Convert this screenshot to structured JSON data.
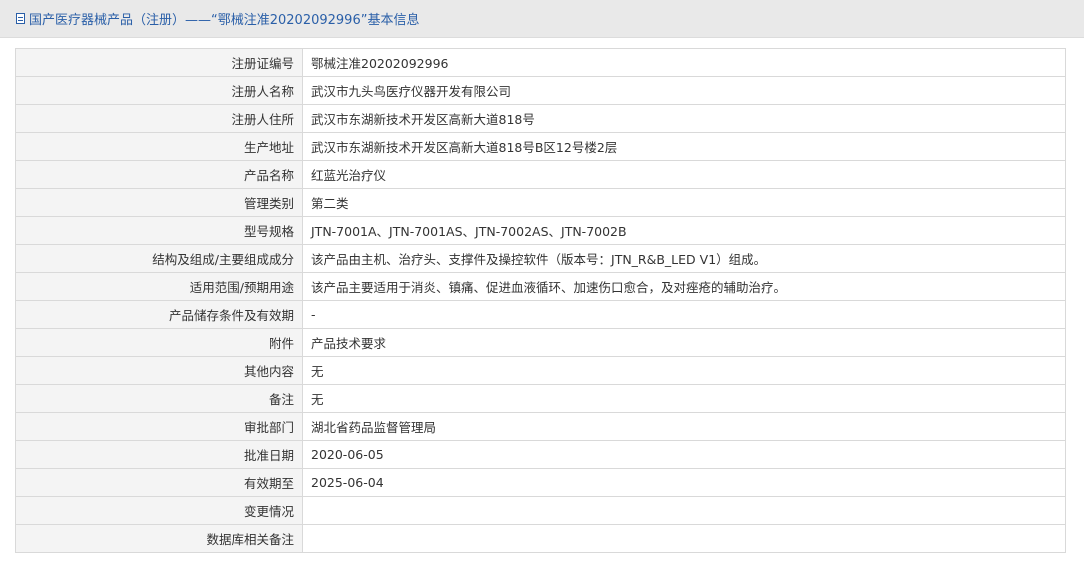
{
  "header": {
    "title": "国产医疗器械产品（注册）——“鄂械注准20202092996”基本信息",
    "icon": "document-icon"
  },
  "colors": {
    "title_text": "#2a5fa8",
    "header_bg": "#e9e9e9",
    "label_bg": "#f4f4f4",
    "border": "#d9d9d9"
  },
  "rows": [
    {
      "label": "注册证编号",
      "value": "鄂械注准20202092996"
    },
    {
      "label": "注册人名称",
      "value": "武汉市九头鸟医疗仪器开发有限公司"
    },
    {
      "label": "注册人住所",
      "value": "武汉市东湖新技术开发区高新大道818号"
    },
    {
      "label": "生产地址",
      "value": "武汉市东湖新技术开发区高新大道818号B区12号楼2层"
    },
    {
      "label": "产品名称",
      "value": "红蓝光治疗仪"
    },
    {
      "label": "管理类别",
      "value": "第二类"
    },
    {
      "label": "型号规格",
      "value": "JTN-7001A、JTN-7001AS、JTN-7002AS、JTN-7002B"
    },
    {
      "label": "结构及组成/主要组成成分",
      "value": "该产品由主机、治疗头、支撑件及操控软件（版本号：JTN_R&B_LED V1）组成。"
    },
    {
      "label": "适用范围/预期用途",
      "value": "该产品主要适用于消炎、镇痛、促进血液循环、加速伤口愈合，及对痤疮的辅助治疗。"
    },
    {
      "label": "产品储存条件及有效期",
      "value": "-"
    },
    {
      "label": "附件",
      "value": "产品技术要求"
    },
    {
      "label": "其他内容",
      "value": "无"
    },
    {
      "label": "备注",
      "value": "无"
    },
    {
      "label": "审批部门",
      "value": "湖北省药品监督管理局"
    },
    {
      "label": "批准日期",
      "value": "2020-06-05"
    },
    {
      "label": "有效期至",
      "value": "2025-06-04"
    },
    {
      "label": "变更情况",
      "value": ""
    },
    {
      "label": "数据库相关备注",
      "value": ""
    }
  ]
}
